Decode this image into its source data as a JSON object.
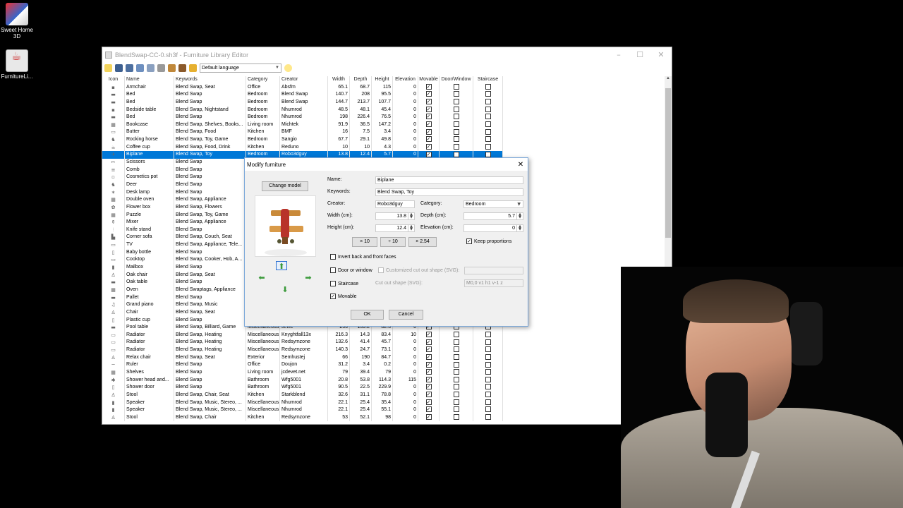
{
  "desktop": {
    "icons": [
      {
        "label": "Sweet Home 3D"
      },
      {
        "label": "FurnitureLi..."
      }
    ]
  },
  "window": {
    "title": "BlendSwap-CC-0.sh3f - Furniture Library Editor",
    "controls": {
      "minimize": "–",
      "maximize": "☐",
      "close": "✕"
    },
    "toolbar": {
      "buttons": [
        "new-icon",
        "open-icon",
        "save-icon",
        "save-as-icon",
        "export-icon",
        "cut-icon",
        "import-icon",
        "import-zip-icon",
        "edit-icon"
      ],
      "language": "Default language",
      "help_icon": "lightbulb-icon"
    }
  },
  "table": {
    "headers": [
      "Icon",
      "Name",
      "Keywords",
      "Category",
      "Creator",
      "Width",
      "Depth",
      "Height",
      "Elevation",
      "Movable",
      "Door/Window",
      "Staircase"
    ],
    "rows": [
      {
        "name": "Armchair",
        "kw": "Blend Swap, Seat",
        "cat": "Office",
        "cre": "Absfm",
        "w": "65.1",
        "d": "68.7",
        "h": "115",
        "el": "0",
        "mv": true
      },
      {
        "name": "Bed",
        "kw": "Blend Swap",
        "cat": "Bedroom",
        "cre": "Blend Swap",
        "w": "140.7",
        "d": "208",
        "h": "95.5",
        "el": "0",
        "mv": true
      },
      {
        "name": "Bed",
        "kw": "Blend Swap",
        "cat": "Bedroom",
        "cre": "Blend Swap",
        "w": "144.7",
        "d": "213.7",
        "h": "107.7",
        "el": "0",
        "mv": true
      },
      {
        "name": "Bedside table",
        "kw": "Blend Swap, Nightstand",
        "cat": "Bedroom",
        "cre": "Nhumrod",
        "w": "48.5",
        "d": "48.1",
        "h": "45.4",
        "el": "0",
        "mv": true
      },
      {
        "name": "Bed",
        "kw": "Blend Swap",
        "cat": "Bedroom",
        "cre": "Nhumrod",
        "w": "198",
        "d": "226.4",
        "h": "76.5",
        "el": "0",
        "mv": true
      },
      {
        "name": "Bookcase",
        "kw": "Blend Swap, Shelves, Books...",
        "cat": "Living room",
        "cre": "Michtek",
        "w": "91.9",
        "d": "36.5",
        "h": "147.2",
        "el": "0",
        "mv": true
      },
      {
        "name": "Butter",
        "kw": "Blend Swap, Food",
        "cat": "Kitchen",
        "cre": "BMF",
        "w": "16",
        "d": "7.5",
        "h": "3.4",
        "el": "0",
        "mv": true
      },
      {
        "name": "Rocking horse",
        "kw": "Blend Swap, Toy, Game",
        "cat": "Bedroom",
        "cre": "Sangio",
        "w": "67.7",
        "d": "29.1",
        "h": "49.8",
        "el": "0",
        "mv": true
      },
      {
        "name": "Coffee cup",
        "kw": "Blend Swap, Food, Drink",
        "cat": "Kitchen",
        "cre": "Reduno",
        "w": "10",
        "d": "10",
        "h": "4.3",
        "el": "0",
        "mv": true
      },
      {
        "name": "Biplane",
        "kw": "Blend Swap, Toy",
        "cat": "Bedroom",
        "cre": "Robo3dguy",
        "w": "13.8",
        "d": "12.4",
        "h": "5.7",
        "el": "0",
        "mv": true,
        "sel": true
      },
      {
        "name": "Scissors",
        "kw": "Blend Swap",
        "cat": "",
        "cre": "",
        "w": "",
        "d": "",
        "h": "",
        "el": "",
        "mv": null
      },
      {
        "name": "Comb",
        "kw": "Blend Swap",
        "cat": "",
        "cre": "",
        "w": "",
        "d": "",
        "h": "",
        "el": "",
        "mv": null
      },
      {
        "name": "Cosmetics pot",
        "kw": "Blend Swap",
        "cat": "",
        "cre": "",
        "w": "",
        "d": "",
        "h": "",
        "el": "",
        "mv": null
      },
      {
        "name": "Deer",
        "kw": "Blend Swap",
        "cat": "",
        "cre": "",
        "w": "",
        "d": "",
        "h": "",
        "el": "",
        "mv": null
      },
      {
        "name": "Desk lamp",
        "kw": "Blend Swap",
        "cat": "",
        "cre": "",
        "w": "",
        "d": "",
        "h": "",
        "el": "",
        "mv": null
      },
      {
        "name": "Double oven",
        "kw": "Blend Swap, Appliance",
        "cat": "",
        "cre": "",
        "w": "",
        "d": "",
        "h": "",
        "el": "",
        "mv": null
      },
      {
        "name": "Flower box",
        "kw": "Blend Swap, Flowers",
        "cat": "",
        "cre": "",
        "w": "",
        "d": "",
        "h": "",
        "el": "",
        "mv": null
      },
      {
        "name": "Puzzle",
        "kw": "Blend Swap, Toy, Game",
        "cat": "",
        "cre": "",
        "w": "",
        "d": "",
        "h": "",
        "el": "",
        "mv": null
      },
      {
        "name": "Mixer",
        "kw": "Blend Swap, Appliance",
        "cat": "",
        "cre": "",
        "w": "",
        "d": "",
        "h": "",
        "el": "",
        "mv": null
      },
      {
        "name": "Knife stand",
        "kw": "Blend Swap",
        "cat": "",
        "cre": "",
        "w": "",
        "d": "",
        "h": "",
        "el": "",
        "mv": null
      },
      {
        "name": "Corner sofa",
        "kw": "Blend Swap, Couch, Seat",
        "cat": "",
        "cre": "",
        "w": "",
        "d": "",
        "h": "",
        "el": "",
        "mv": null
      },
      {
        "name": "TV",
        "kw": "Blend Swap, Appliance, Tele...",
        "cat": "",
        "cre": "",
        "w": "",
        "d": "",
        "h": "",
        "el": "",
        "mv": null
      },
      {
        "name": "Baby bottle",
        "kw": "Blend Swap",
        "cat": "",
        "cre": "",
        "w": "",
        "d": "",
        "h": "",
        "el": "",
        "mv": null
      },
      {
        "name": "Cooktop",
        "kw": "Blend Swap, Cooker, Hob, A...",
        "cat": "",
        "cre": "",
        "w": "",
        "d": "",
        "h": "",
        "el": "",
        "mv": null
      },
      {
        "name": "Mailbox",
        "kw": "Blend Swap",
        "cat": "",
        "cre": "",
        "w": "",
        "d": "",
        "h": "",
        "el": "",
        "mv": null
      },
      {
        "name": "Oak chair",
        "kw": "Blend Swap, Seat",
        "cat": "",
        "cre": "",
        "w": "",
        "d": "",
        "h": "",
        "el": "",
        "mv": null
      },
      {
        "name": "Oak table",
        "kw": "Blend Swap",
        "cat": "",
        "cre": "",
        "w": "",
        "d": "",
        "h": "",
        "el": "",
        "mv": null
      },
      {
        "name": "Oven",
        "kw": "Blend Swaptags, Appliance",
        "cat": "",
        "cre": "",
        "w": "",
        "d": "",
        "h": "",
        "el": "",
        "mv": null
      },
      {
        "name": "Pallet",
        "kw": "Blend Swap",
        "cat": "",
        "cre": "",
        "w": "",
        "d": "",
        "h": "",
        "el": "",
        "mv": null
      },
      {
        "name": "Grand piano",
        "kw": "Blend Swap, Music",
        "cat": "",
        "cre": "",
        "w": "",
        "d": "",
        "h": "",
        "el": "",
        "mv": null
      },
      {
        "name": "Chair",
        "kw": "Blend Swap, Seat",
        "cat": "",
        "cre": "",
        "w": "",
        "d": "",
        "h": "",
        "el": "",
        "mv": null
      },
      {
        "name": "Plastic cup",
        "kw": "Blend Swap",
        "cat": "",
        "cre": "",
        "w": "",
        "d": "",
        "h": "",
        "el": "",
        "mv": null
      },
      {
        "name": "Pool table",
        "kw": "Blend Swap, Billiard, Game",
        "cat": "Miscellaneous",
        "cre": "Jeffie",
        "w": "256",
        "d": "139.2",
        "h": "82.3",
        "el": "0",
        "mv": true
      },
      {
        "name": "Radiator",
        "kw": "Blend Swap, Heating",
        "cat": "Miscellaneous",
        "cre": "Knyghtfall13x",
        "w": "216.3",
        "d": "14.3",
        "h": "83.4",
        "el": "10",
        "mv": true
      },
      {
        "name": "Radiator",
        "kw": "Blend Swap, Heating",
        "cat": "Miscellaneous",
        "cre": "Redsymzone",
        "w": "132.6",
        "d": "41.4",
        "h": "45.7",
        "el": "0",
        "mv": true
      },
      {
        "name": "Radiator",
        "kw": "Blend Swap, Heating",
        "cat": "Miscellaneous",
        "cre": "Redsymzone",
        "w": "140.3",
        "d": "24.7",
        "h": "73.1",
        "el": "0",
        "mv": true
      },
      {
        "name": "Relax chair",
        "kw": "Blend Swap, Seat",
        "cat": "Exterior",
        "cre": "Semhustej",
        "w": "66",
        "d": "190",
        "h": "84.7",
        "el": "0",
        "mv": true
      },
      {
        "name": "Ruler",
        "kw": "Blend Swap",
        "cat": "Office",
        "cre": "Doujon",
        "w": "31.2",
        "d": "3.4",
        "h": "0.2",
        "el": "0",
        "mv": true
      },
      {
        "name": "Shelves",
        "kw": "Blend Swap",
        "cat": "Living room",
        "cre": "jcdevet.net",
        "w": "79",
        "d": "39.4",
        "h": "79",
        "el": "0",
        "mv": true
      },
      {
        "name": "Shower head and...",
        "kw": "Blend Swap",
        "cat": "Bathroom",
        "cre": "Wfg5001",
        "w": "20.8",
        "d": "53.8",
        "h": "114.3",
        "el": "115",
        "mv": true
      },
      {
        "name": "Shower door",
        "kw": "Blend Swap",
        "cat": "Bathroom",
        "cre": "Wfg5001",
        "w": "90.5",
        "d": "22.5",
        "h": "229.9",
        "el": "0",
        "mv": true
      },
      {
        "name": "Stool",
        "kw": "Blend Swap, Chair, Seat",
        "cat": "Kitchen",
        "cre": "Starkblend",
        "w": "32.6",
        "d": "31.1",
        "h": "78.8",
        "el": "0",
        "mv": true
      },
      {
        "name": "Speaker",
        "kw": "Blend Swap, Music, Stereo, ...",
        "cat": "Miscellaneous",
        "cre": "Nhumrod",
        "w": "22.1",
        "d": "25.4",
        "h": "35.4",
        "el": "0",
        "mv": true
      },
      {
        "name": "Speaker",
        "kw": "Blend Swap, Music, Stereo, ...",
        "cat": "Miscellaneous",
        "cre": "Nhumrod",
        "w": "22.1",
        "d": "25.4",
        "h": "55.1",
        "el": "0",
        "mv": true
      },
      {
        "name": "Stool",
        "kw": "Blend Swap, Chair",
        "cat": "Kitchen",
        "cre": "Redsymzone",
        "w": "53",
        "d": "52.1",
        "h": "98",
        "el": "0",
        "mv": true
      }
    ]
  },
  "dialog": {
    "title": "Modify furniture",
    "change_model": "Change model",
    "labels": {
      "name": "Name:",
      "keywords": "Keywords:",
      "creator": "Creator:",
      "category": "Category:",
      "width": "Width (cm):",
      "depth": "Depth (cm):",
      "height": "Height (cm):",
      "elevation": "Elevation (cm):"
    },
    "values": {
      "name": "Biplane",
      "keywords": "Blend Swap, Toy",
      "creator": "Robo3dguy",
      "category": "Bedroom",
      "width": "13.8",
      "depth": "5.7",
      "height": "12.4",
      "elevation": "0"
    },
    "scale_buttons": [
      "× 10",
      "÷ 10",
      "× 2.54"
    ],
    "keep_proportions": "Keep proportions",
    "invert_faces": "Invert back and front faces",
    "door_or_window": "Door or window",
    "customized_cut_out": "Customized cut out shape (SVG):",
    "staircase": "Staircase",
    "cut_out_shape_label": "Cut out shape (SVG):",
    "cut_out_shape_value": "M0,0 v1 h1 v-1 z",
    "movable": "Movable",
    "ok": "OK",
    "cancel": "Cancel"
  },
  "colors": {
    "selection": "#0078d7",
    "dialog_bg": "#f0f0f0",
    "accent_arrow": "#3a9a3a"
  }
}
